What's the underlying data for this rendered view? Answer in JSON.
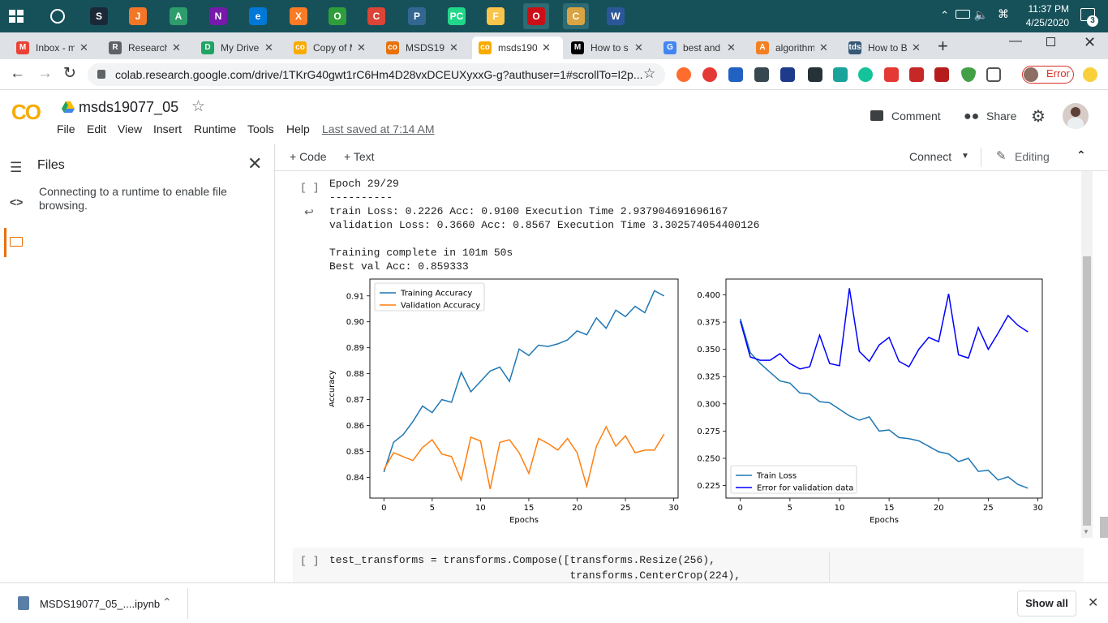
{
  "taskbar": {
    "clock_time": "11:37 PM",
    "clock_date": "4/25/2020",
    "notification_count": "3",
    "apps": [
      {
        "name": "steam",
        "color": "#1b2838",
        "glyph": "S"
      },
      {
        "name": "jupyter",
        "color": "#f37626",
        "glyph": "J"
      },
      {
        "name": "atom",
        "color": "#2e9d6c",
        "glyph": "A"
      },
      {
        "name": "onenote",
        "color": "#7719aa",
        "glyph": "N"
      },
      {
        "name": "edge",
        "color": "#0078d7",
        "glyph": "e"
      },
      {
        "name": "xampp",
        "color": "#fb7a24",
        "glyph": "X"
      },
      {
        "name": "circle-app",
        "color": "#2f9e3a",
        "glyph": "O"
      },
      {
        "name": "chrome",
        "color": "#db4437",
        "glyph": "C"
      },
      {
        "name": "postgres",
        "color": "#336791",
        "glyph": "P"
      },
      {
        "name": "pycharm",
        "color": "#21d789",
        "glyph": "PC"
      },
      {
        "name": "file-explorer",
        "color": "#f8c44a",
        "glyph": "F"
      },
      {
        "name": "opera",
        "color": "#cc0f16",
        "glyph": "O"
      },
      {
        "name": "chrome-canary",
        "color": "#d9a441",
        "glyph": "C"
      },
      {
        "name": "word",
        "color": "#2b579a",
        "glyph": "W"
      }
    ]
  },
  "tabs": [
    {
      "label": "Inbox - m",
      "fav": "M",
      "color": "#ea4335"
    },
    {
      "label": "Research",
      "fav": "R",
      "color": "#5f6368"
    },
    {
      "label": "My Drive",
      "fav": "D",
      "color": "#1fa463"
    },
    {
      "label": "Copy of M",
      "fav": "co",
      "color": "#f9ab00"
    },
    {
      "label": "MSDS19",
      "fav": "co",
      "color": "#e8710a"
    },
    {
      "label": "msds190",
      "fav": "co",
      "color": "#f9ab00"
    },
    {
      "label": "How to s",
      "fav": "M",
      "color": "#000000"
    },
    {
      "label": "best and",
      "fav": "G",
      "color": "#4285f4"
    },
    {
      "label": "algorithm",
      "fav": "A",
      "color": "#f48024"
    },
    {
      "label": "How to B",
      "fav": "tds",
      "color": "#355876"
    }
  ],
  "address": {
    "url": "colab.research.google.com/drive/1TKrG40gwt1rC6Hm4D28vxDCEUXyxxG-g?authuser=1#scrollTo=I2p...",
    "error_label": "Error"
  },
  "colab": {
    "logo": "CO",
    "notebook_name": "msds19077_05",
    "menu": [
      "File",
      "Edit",
      "View",
      "Insert",
      "Runtime",
      "Tools",
      "Help"
    ],
    "last_saved": "Last saved at 7:14 AM",
    "comment_label": "Comment",
    "share_label": "Share"
  },
  "side": {
    "title": "Files",
    "message": "Connecting to a runtime to enable file browsing."
  },
  "toolbar": {
    "code_label": "+ Code",
    "text_label": "+ Text",
    "connect_label": "Connect",
    "editing_label": "Editing"
  },
  "cell_output": {
    "run_indicator": "[ ]",
    "lines": [
      "Epoch 29/29",
      "----------",
      "train Loss: 0.2226 Acc: 0.9100 Execution Time 2.937904691696167",
      "validation Loss: 0.3660 Acc: 0.8567 Execution Time 3.302574054400126",
      "",
      "Training complete in 101m 50s",
      "Best val Acc: 0.859333"
    ]
  },
  "next_cell": {
    "run_indicator": "[ ]",
    "line1": "test_transforms = transforms.Compose([transforms.Resize(256),",
    "line2": "                                      transforms.CenterCrop(224),"
  },
  "downloads": {
    "file_name": "MSDS19077_05_....ipynb",
    "show_all": "Show all"
  },
  "chart_data": [
    {
      "type": "line",
      "xlabel": "Epochs",
      "ylabel": "Accuracy",
      "xlim": [
        -1.45,
        30.45
      ],
      "ylim": [
        0.832,
        0.9165
      ],
      "xticks": [
        0,
        5,
        10,
        15,
        20,
        25,
        30
      ],
      "yticks": [
        0.84,
        0.85,
        0.86,
        0.87,
        0.88,
        0.89,
        0.9,
        0.91
      ],
      "legend": "top-left",
      "x": [
        0,
        1,
        2,
        3,
        4,
        5,
        6,
        7,
        8,
        9,
        10,
        11,
        12,
        13,
        14,
        15,
        16,
        17,
        18,
        19,
        20,
        21,
        22,
        23,
        24,
        25,
        26,
        27,
        28,
        29
      ],
      "series": [
        {
          "name": "Training Accuracy",
          "color": "#1f77b4",
          "values": [
            0.842,
            0.8535,
            0.8565,
            0.8615,
            0.8675,
            0.865,
            0.87,
            0.869,
            0.8805,
            0.873,
            0.877,
            0.881,
            0.8825,
            0.877,
            0.8895,
            0.887,
            0.891,
            0.8905,
            0.8915,
            0.893,
            0.8965,
            0.895,
            0.9015,
            0.8975,
            0.9045,
            0.902,
            0.906,
            0.9035,
            0.912,
            0.91
          ]
        },
        {
          "name": "Validation Accuracy",
          "color": "#ff7f0e",
          "values": [
            0.843,
            0.8495,
            0.848,
            0.8465,
            0.8515,
            0.8545,
            0.849,
            0.848,
            0.839,
            0.8555,
            0.854,
            0.8355,
            0.8535,
            0.8545,
            0.8495,
            0.8415,
            0.855,
            0.853,
            0.8505,
            0.855,
            0.8495,
            0.8365,
            0.852,
            0.8595,
            0.852,
            0.856,
            0.8495,
            0.8505,
            0.8505,
            0.8567
          ]
        }
      ]
    },
    {
      "type": "line",
      "xlabel": "Epochs",
      "ylabel": "Loss",
      "xlim": [
        -1.45,
        30.45
      ],
      "ylim": [
        0.2135,
        0.4145
      ],
      "xticks": [
        0,
        5,
        10,
        15,
        20,
        25,
        30
      ],
      "yticks": [
        0.225,
        0.25,
        0.275,
        0.3,
        0.325,
        0.35,
        0.375,
        0.4
      ],
      "legend": "bottom-left",
      "x": [
        0,
        1,
        2,
        3,
        4,
        5,
        6,
        7,
        8,
        9,
        10,
        11,
        12,
        13,
        14,
        15,
        16,
        17,
        18,
        19,
        20,
        21,
        22,
        23,
        24,
        25,
        26,
        27,
        28,
        29
      ],
      "series": [
        {
          "name": "Train Loss",
          "color": "#1f77b4",
          "values": [
            0.378,
            0.347,
            0.337,
            0.329,
            0.321,
            0.319,
            0.31,
            0.309,
            0.302,
            0.301,
            0.295,
            0.289,
            0.285,
            0.288,
            0.275,
            0.276,
            0.269,
            0.268,
            0.266,
            0.261,
            0.256,
            0.254,
            0.247,
            0.25,
            0.238,
            0.239,
            0.23,
            0.233,
            0.226,
            0.2226
          ]
        },
        {
          "name": "Error for validation data",
          "color": "#0000ff",
          "values": [
            0.376,
            0.343,
            0.34,
            0.34,
            0.346,
            0.337,
            0.332,
            0.334,
            0.363,
            0.337,
            0.335,
            0.406,
            0.348,
            0.339,
            0.354,
            0.361,
            0.339,
            0.334,
            0.35,
            0.361,
            0.357,
            0.401,
            0.345,
            0.342,
            0.37,
            0.35,
            0.365,
            0.381,
            0.372,
            0.366
          ]
        }
      ]
    }
  ]
}
